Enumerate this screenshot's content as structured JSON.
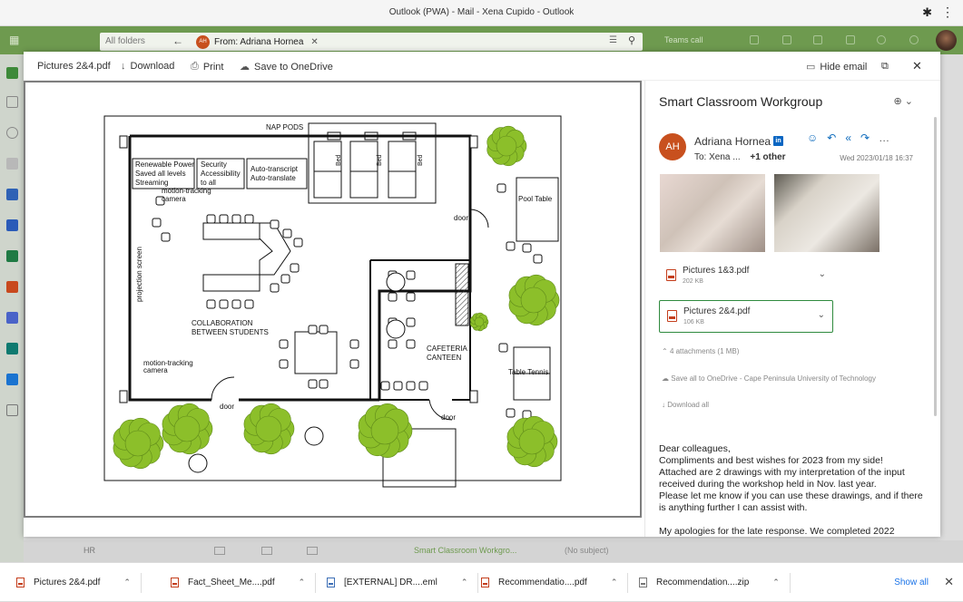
{
  "window": {
    "title": "Outlook (PWA) - Mail - Xena Cupido - Outlook"
  },
  "searchbar": {
    "folder": "All folders",
    "chip_initials": "AH",
    "chip_label": "From: Adriana Hornea",
    "teams_label": "Teams call"
  },
  "viewer_toolbar": {
    "filename": "Pictures 2&4.pdf",
    "download": "Download",
    "print": "Print",
    "save": "Save to OneDrive",
    "hide_email": "Hide email"
  },
  "email": {
    "subject": "Smart Classroom Workgroup",
    "sender_initials": "AH",
    "sender": "Adriana Hornea",
    "to_label": "To:",
    "to_name": "Xena ...",
    "to_more": "+1 other",
    "date": "Wed 2023/01/18 16:37",
    "attachments": [
      {
        "name": "Pictures 1&3.pdf",
        "size": "202 KB"
      },
      {
        "name": "Pictures 2&4.pdf",
        "size": "106 KB"
      }
    ],
    "attachments_count": "4 attachments (1 MB)",
    "save_all": "Save all to OneDrive - Cape Peninsula University of Technology",
    "download_all": "Download all",
    "body": [
      "Dear colleagues,\nCompliments and best wishes for 2023 from my side!\nAttached are 2 drawings with my interpretation of the input received during the workshop held in Nov. last year.\nPlease let me know if you can use these drawings, and if there is anything further I can assist with.",
      "My apologies for the late response. We completed 2022"
    ]
  },
  "floorplan": {
    "nap_pods": "NAP PODS",
    "bed": "Bed",
    "box1": [
      "Renewable Power",
      "Saved all levels",
      "Streaming"
    ],
    "box2": [
      "Security",
      "Accessibility",
      "to all"
    ],
    "box3": [
      "Auto-transcript",
      "Auto-translate"
    ],
    "camera": [
      "motion-tracking",
      "camera"
    ],
    "projection": "projection screen",
    "collab": [
      "COLLABORATION",
      "BETWEEN STUDENTS"
    ],
    "door": "door",
    "pool": "Pool Table",
    "cafeteria": [
      "CAFETERIA /",
      "CANTEEN"
    ],
    "tennis": "Table Tennis"
  },
  "behind": {
    "hr": "HR",
    "subject": "Smart Classroom Workgro...",
    "nosubject": "(No subject)"
  },
  "downloads": [
    {
      "name": "Pictures 2&4.pdf",
      "type": "pdf"
    },
    {
      "name": "Fact_Sheet_Me....pdf",
      "type": "pdf"
    },
    {
      "name": "[EXTERNAL] DR....eml",
      "type": "eml"
    },
    {
      "name": "Recommendatio....pdf",
      "type": "pdf"
    },
    {
      "name": "Recommendation....zip",
      "type": "zip"
    }
  ],
  "downloads_show_all": "Show all",
  "colors": {
    "accent": "#6e9a4f",
    "avatar": "#c8501e",
    "link": "#0f6cbd",
    "tree": "#8cbf2a"
  }
}
